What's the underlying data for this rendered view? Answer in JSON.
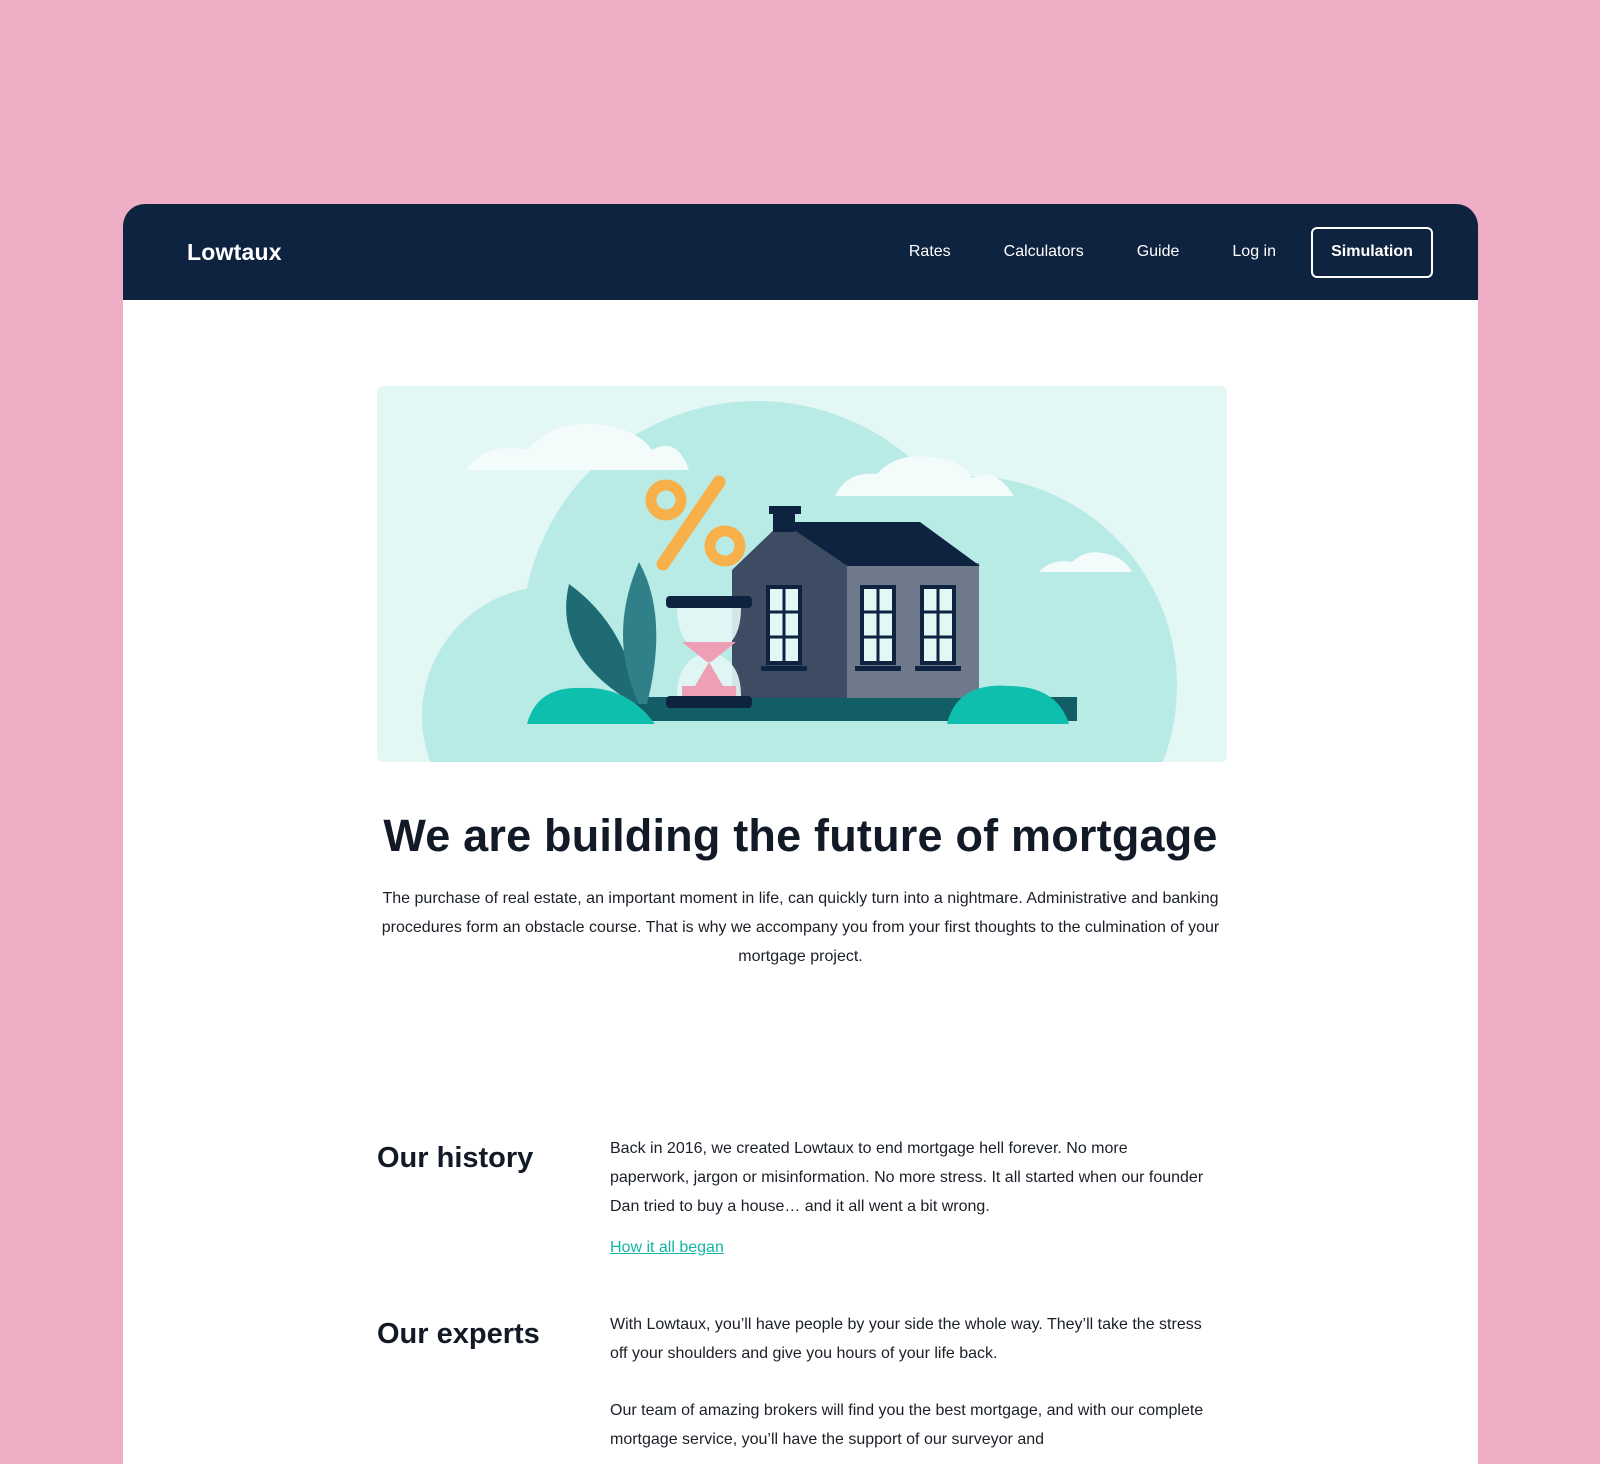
{
  "nav": {
    "brand": "Lowtaux",
    "links": [
      "Rates",
      "Calculators",
      "Guide",
      "Log in"
    ],
    "cta": "Simulation"
  },
  "hero": {
    "illustration": "house-illustration",
    "colors": {
      "bg": "#e3f7f5",
      "teal": "#b9ebe6",
      "house_dark": "#3d4b63",
      "house_side": "#6e7a8c",
      "roof": "#0e2340",
      "percent": "#f7b04a",
      "leaf": "#1e6b74",
      "bush": "#0fbfae",
      "sand": "#ee9fb5"
    }
  },
  "headline": "We are building the future of mortgage",
  "intro": "The purchase of real estate, an important moment in life, can quickly turn into a nightmare. Administrative and banking procedures form an obstacle course. That is why we accompany you from your first thoughts to the culmination of your mortgage project.",
  "sections": [
    {
      "title": "Our history",
      "body": "Back in 2016, we created Lowtaux to end mortgage hell forever. No more paperwork, jargon or misinformation. No more stress. It all started when our founder Dan tried to buy a house… and it all went a bit wrong.",
      "link": "How it all began"
    },
    {
      "title": "Our experts",
      "body": "With Lowtaux, you’ll have people by your side the whole way. They’ll take the stress off your shoulders and give you hours of your life back.",
      "body2": "Our team of amazing brokers will find you the best mortgage, and with our complete mortgage service, you’ll have the support of our surveyor and"
    }
  ]
}
